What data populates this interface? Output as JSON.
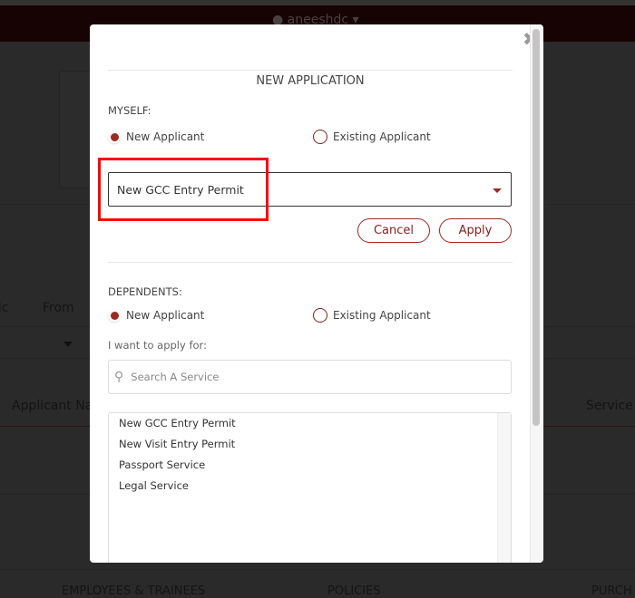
{
  "header": {
    "username": "aneeshdc"
  },
  "background": {
    "col_partial": "lic",
    "from_label": "From",
    "applicant_name": "Applicant Nam",
    "service": "Service",
    "footer": [
      "EMPLOYEES & TRAINEES",
      "POLICIES",
      "PURCH"
    ]
  },
  "modal": {
    "title": "NEW APPLICATION",
    "myself": {
      "label": "MYSELF:",
      "options": [
        "New Applicant",
        "Existing Applicant"
      ],
      "selected": "New Applicant",
      "select_value": "New GCC Entry Permit",
      "cancel": "Cancel",
      "apply": "Apply"
    },
    "dependents": {
      "label": "DEPENDENTS:",
      "options": [
        "New Applicant",
        "Existing Applicant"
      ],
      "selected": "New Applicant",
      "apply_for_label": "I want to apply for:",
      "search_placeholder": "Search A Service",
      "services": [
        "New GCC Entry Permit",
        "New Visit Entry Permit",
        "Passport Service",
        "Legal Service"
      ]
    }
  },
  "colors": {
    "accent": "#9b2a22",
    "header": "#170303",
    "overlay": "#2a2a2a",
    "highlight": "#ff0000"
  }
}
